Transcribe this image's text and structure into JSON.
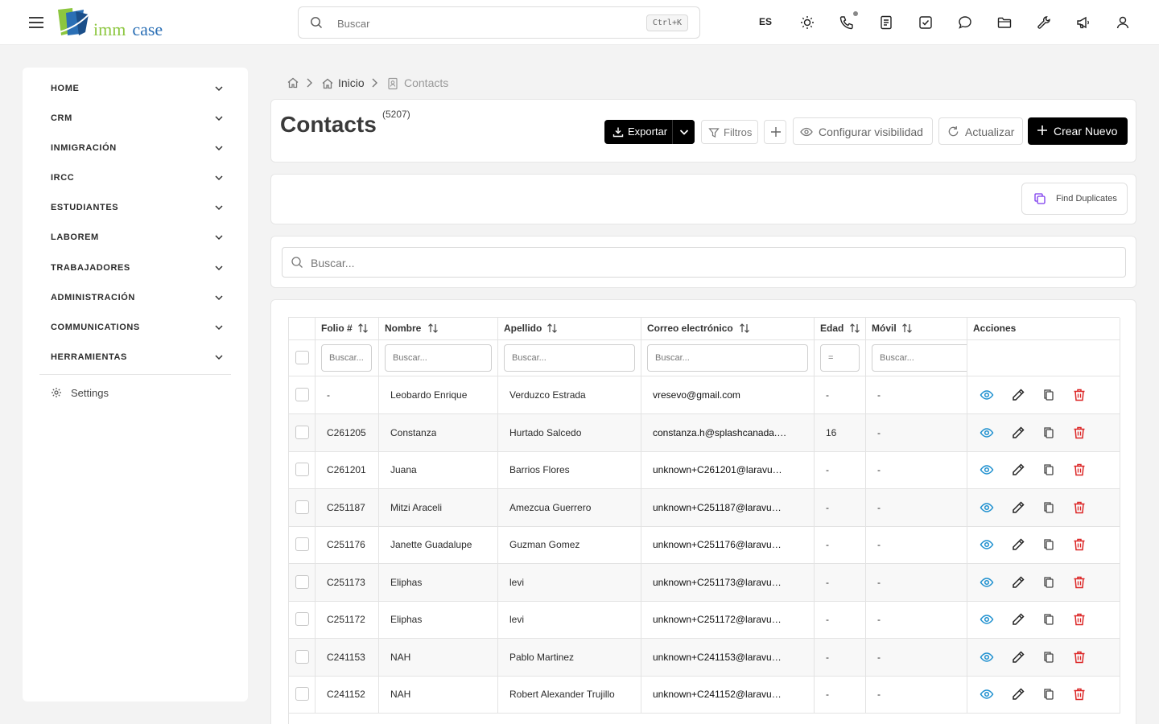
{
  "header": {
    "logo_imm": "imm",
    "logo_case": "case",
    "search_placeholder": "Buscar",
    "shortcut": "Ctrl+K",
    "language": "ES",
    "icons": [
      "sun-icon",
      "phone-icon",
      "document-icon",
      "task-check-icon",
      "chat-icon",
      "folder-icon",
      "wrench-icon",
      "megaphone-icon",
      "user-icon"
    ]
  },
  "sidebar": {
    "items": [
      {
        "label": "HOME"
      },
      {
        "label": "CRM"
      },
      {
        "label": "INMIGRACIÓN"
      },
      {
        "label": "IRCC"
      },
      {
        "label": "ESTUDIANTES"
      },
      {
        "label": "LABOREM"
      },
      {
        "label": "TRABAJADORES"
      },
      {
        "label": "ADMINISTRACIÓN"
      },
      {
        "label": "COMMUNICATIONS"
      },
      {
        "label": "HERRAMIENTAS"
      }
    ],
    "settings_label": "Settings"
  },
  "breadcrumb": {
    "inicio": "Inicio",
    "current": "Contacts"
  },
  "page": {
    "title": "Contacts",
    "count": "(5207)"
  },
  "toolbar": {
    "export_label": "Exportar",
    "filters_label": "Filtros",
    "visibility_label": "Configurar visibilidad",
    "refresh_label": "Actualizar",
    "create_label": "Crear Nuevo",
    "find_duplicates_label": "Find Duplicates"
  },
  "table_search": {
    "placeholder": "Buscar..."
  },
  "table": {
    "columns": {
      "folio": "Folio #",
      "nombre": "Nombre",
      "apellido": "Apellido",
      "correo": "Correo electrónico",
      "edad": "Edad",
      "movil": "Móvil",
      "acciones": "Acciones"
    },
    "filters": {
      "folio": "Buscar...",
      "nombre": "Buscar...",
      "apellido": "Buscar...",
      "correo": "Buscar...",
      "edad": "=",
      "movil": "Buscar..."
    },
    "rows": [
      {
        "folio": "-",
        "nombre": "Leobardo Enrique",
        "apellido": "Verduzco Estrada",
        "correo": "vresevo@gmail.com",
        "edad": "-",
        "movil": "-"
      },
      {
        "folio": "C261205",
        "nombre": "Constanza",
        "apellido": "Hurtado Salcedo",
        "correo": "constanza.h@splashcanada.…",
        "edad": "16",
        "movil": "-"
      },
      {
        "folio": "C261201",
        "nombre": "Juana",
        "apellido": "Barrios Flores",
        "correo": "unknown+C261201@laravu…",
        "edad": "-",
        "movil": "-"
      },
      {
        "folio": "C251187",
        "nombre": "Mitzi Araceli",
        "apellido": "Amezcua Guerrero",
        "correo": "unknown+C251187@laravu…",
        "edad": "-",
        "movil": "-"
      },
      {
        "folio": "C251176",
        "nombre": "Janette Guadalupe",
        "apellido": "Guzman Gomez",
        "correo": "unknown+C251176@laravu…",
        "edad": "-",
        "movil": "-"
      },
      {
        "folio": "C251173",
        "nombre": "Eliphas",
        "apellido": "levi",
        "correo": "unknown+C251173@laravu…",
        "edad": "-",
        "movil": "-"
      },
      {
        "folio": "C251172",
        "nombre": "Eliphas",
        "apellido": "levi",
        "correo": "unknown+C251172@laravu…",
        "edad": "-",
        "movil": "-"
      },
      {
        "folio": "C241153",
        "nombre": "NAH",
        "apellido": "Pablo Martinez",
        "correo": "unknown+C241153@laravu…",
        "edad": "-",
        "movil": "-"
      },
      {
        "folio": "C241152",
        "nombre": "NAH",
        "apellido": "Robert Alexander Trujillo",
        "correo": "unknown+C241152@laravu…",
        "edad": "-",
        "movil": "-"
      }
    ]
  },
  "colors": {
    "view_icon": "#1c8fcf",
    "delete_icon": "#dc2626",
    "duplicates_icon": "#7c3aed",
    "primary_button": "#000000"
  }
}
